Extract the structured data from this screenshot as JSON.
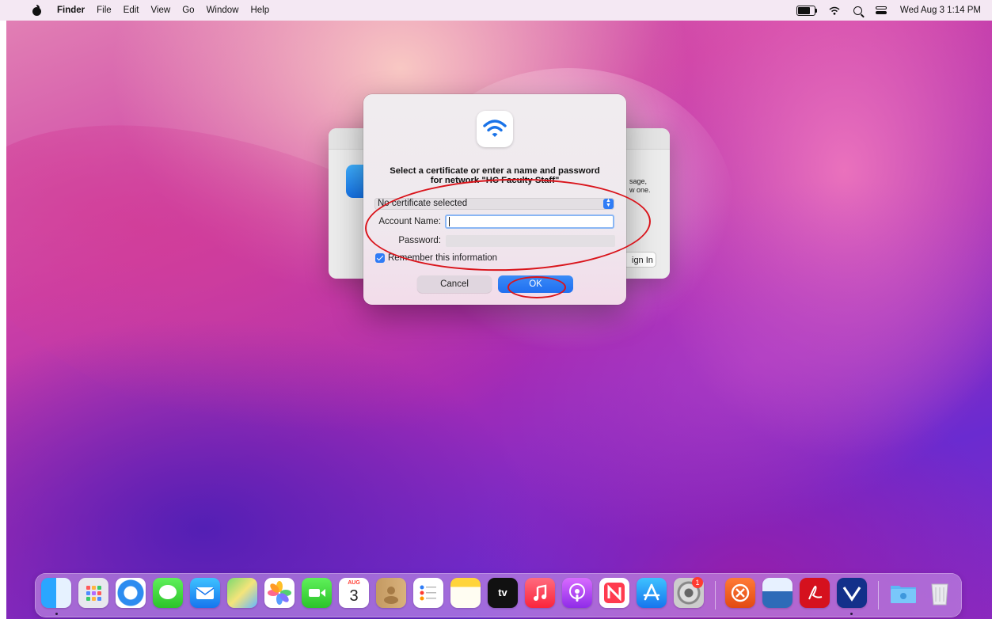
{
  "menubar": {
    "app_name": "Finder",
    "items": [
      "File",
      "Edit",
      "View",
      "Go",
      "Window",
      "Help"
    ],
    "clock": "Wed Aug 3  1:14 PM",
    "status_icons": [
      "battery-icon",
      "wifi-icon",
      "spotlight-icon",
      "control-center-icon"
    ]
  },
  "background_window": {
    "message_line1": "sage,",
    "message_line2": "w one.",
    "button_label": "ign In"
  },
  "dialog": {
    "icon": "wifi-icon",
    "prompt_line1": "Select a certificate or enter a name and password",
    "prompt_line2": "for network \"HC Faculty Staff\"",
    "certificate": {
      "selected": "No certificate selected"
    },
    "account_name": {
      "label": "Account Name:",
      "value": ""
    },
    "password": {
      "label": "Password:",
      "value": ""
    },
    "remember": {
      "label": "Remember this information",
      "checked": true
    },
    "cancel_label": "Cancel",
    "ok_label": "OK"
  },
  "dock": {
    "calendar_month": "AUG",
    "calendar_day": "3",
    "tv_label": "tv",
    "system_prefs_badge": "1",
    "items": [
      "finder-icon",
      "launchpad-icon",
      "safari-icon",
      "messages-icon",
      "mail-icon",
      "maps-icon",
      "photos-icon",
      "facetime-icon",
      "calendar-icon",
      "contacts-icon",
      "reminders-icon",
      "notes-icon",
      "apple-tv-icon",
      "music-icon",
      "podcasts-icon",
      "news-icon",
      "app-store-icon",
      "system-preferences-icon",
      "remote-desktop-icon",
      "preview-icon",
      "acrobat-icon",
      "vpn-icon",
      "downloads-folder-icon",
      "trash-icon"
    ]
  },
  "colors": {
    "accent_blue": "#2f7cf6",
    "annotation_red": "#d9141b",
    "menubar_bg": "#f4e8f3"
  }
}
